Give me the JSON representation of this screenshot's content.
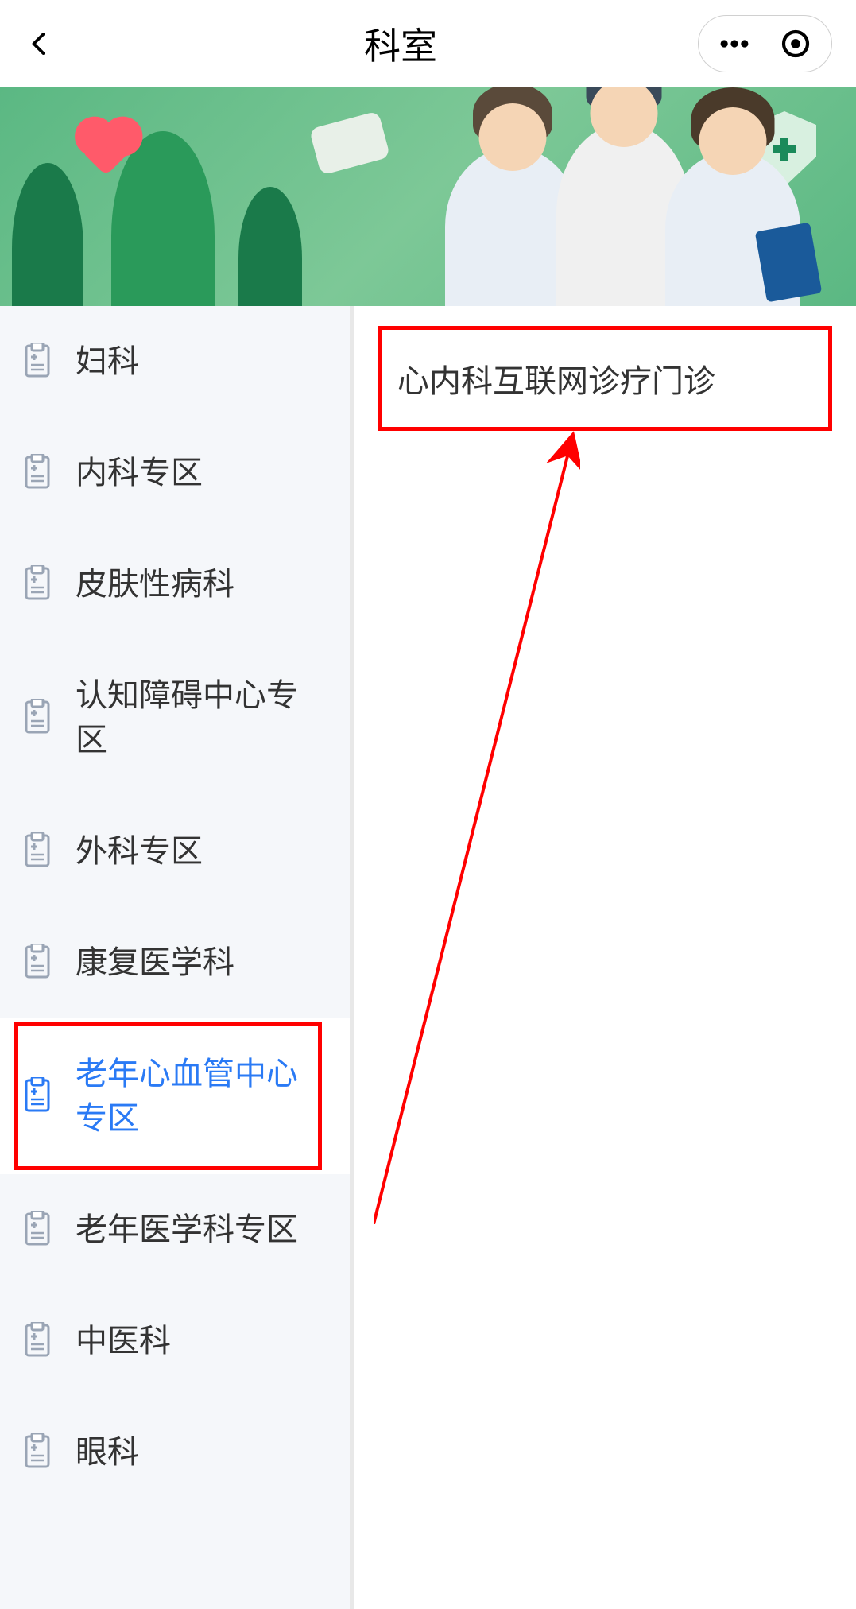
{
  "header": {
    "title": "科室"
  },
  "sidebar": {
    "items": [
      {
        "label": "妇科",
        "active": false
      },
      {
        "label": "内科专区",
        "active": false
      },
      {
        "label": "皮肤性病科",
        "active": false
      },
      {
        "label": "认知障碍中心专区",
        "active": false
      },
      {
        "label": "外科专区",
        "active": false
      },
      {
        "label": "康复医学科",
        "active": false
      },
      {
        "label": "老年心血管中心专区",
        "active": true,
        "highlighted": true
      },
      {
        "label": "老年医学科专区",
        "active": false
      },
      {
        "label": "中医科",
        "active": false
      },
      {
        "label": "眼科",
        "active": false
      }
    ]
  },
  "content": {
    "items": [
      {
        "label": "心内科互联网诊疗门诊",
        "highlighted": true
      }
    ]
  }
}
